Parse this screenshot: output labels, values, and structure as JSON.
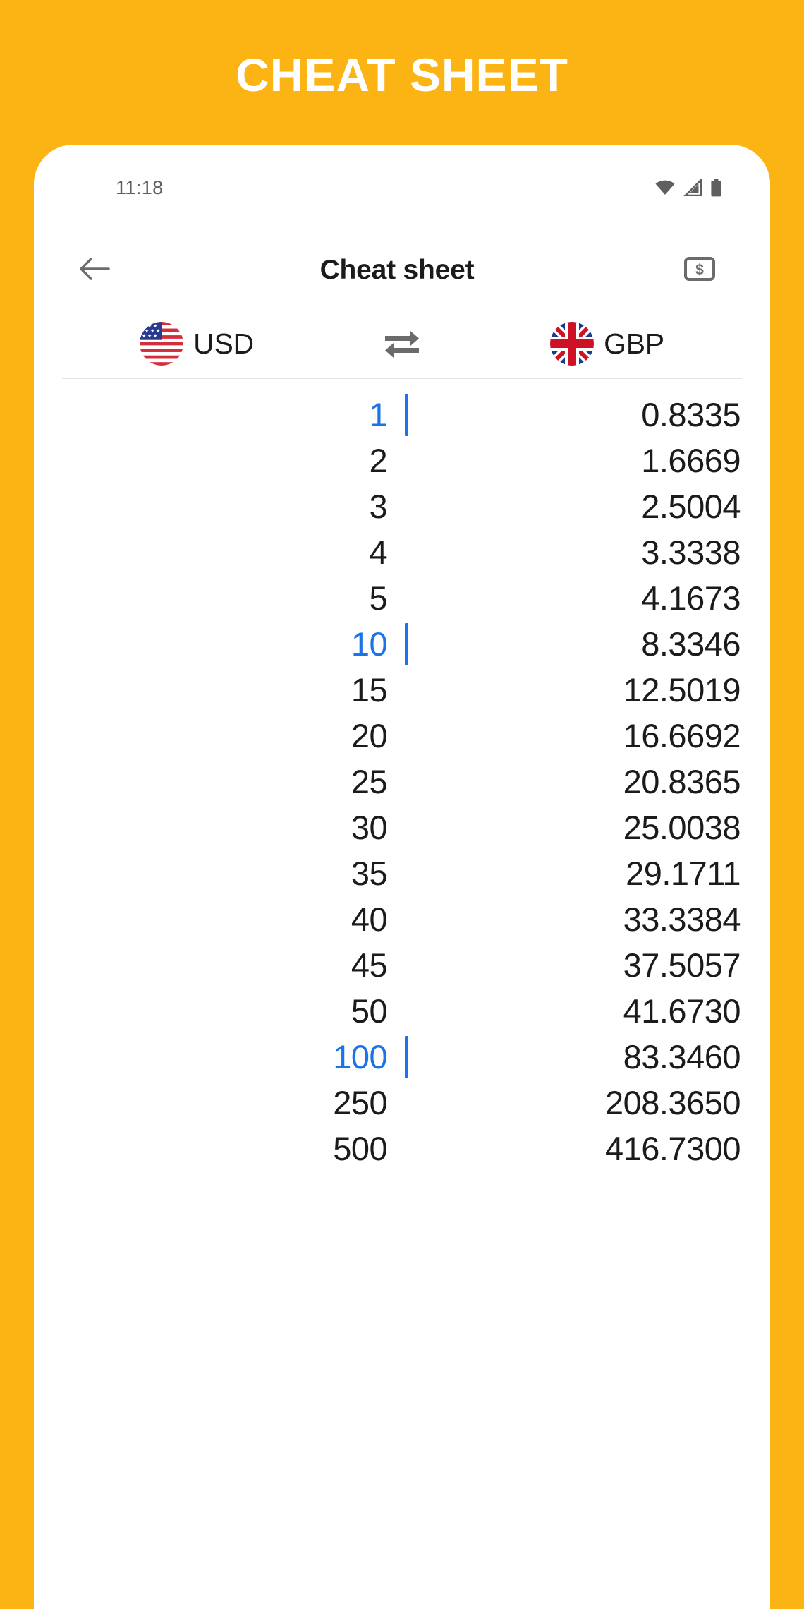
{
  "promo": {
    "headline": "CHEAT SHEET",
    "background_color": "#FCB415",
    "headline_color": "#FFFFFF"
  },
  "status_bar": {
    "time": "11:18",
    "icons": [
      "wifi-icon",
      "cell-signal-icon",
      "battery-icon"
    ],
    "icon_color": "#5F5F5F"
  },
  "app_bar": {
    "back_icon": "back-arrow-icon",
    "title": "Cheat sheet",
    "action_icon": "banknote-dollar-icon"
  },
  "currency_selector": {
    "from": {
      "code": "USD",
      "flag": "us-flag-icon"
    },
    "swap_icon": "swap-arrows-icon",
    "to": {
      "code": "GBP",
      "flag": "gb-flag-icon"
    }
  },
  "theme": {
    "accent": "#1A73E8",
    "text": "#1B1B1B",
    "muted": "#5F5F5F",
    "divider": "#E4E4E4"
  },
  "chart_data": {
    "type": "table",
    "title": "Cheat sheet",
    "columns": [
      "USD",
      "GBP"
    ],
    "rate": 0.8335,
    "xlabel": "USD",
    "ylabel": "GBP",
    "rows": [
      {
        "amount": "1",
        "converted": "0.8335",
        "highlight": true
      },
      {
        "amount": "2",
        "converted": "1.6669",
        "highlight": false
      },
      {
        "amount": "3",
        "converted": "2.5004",
        "highlight": false
      },
      {
        "amount": "4",
        "converted": "3.3338",
        "highlight": false
      },
      {
        "amount": "5",
        "converted": "4.1673",
        "highlight": false
      },
      {
        "amount": "10",
        "converted": "8.3346",
        "highlight": true
      },
      {
        "amount": "15",
        "converted": "12.5019",
        "highlight": false
      },
      {
        "amount": "20",
        "converted": "16.6692",
        "highlight": false
      },
      {
        "amount": "25",
        "converted": "20.8365",
        "highlight": false
      },
      {
        "amount": "30",
        "converted": "25.0038",
        "highlight": false
      },
      {
        "amount": "35",
        "converted": "29.1711",
        "highlight": false
      },
      {
        "amount": "40",
        "converted": "33.3384",
        "highlight": false
      },
      {
        "amount": "45",
        "converted": "37.5057",
        "highlight": false
      },
      {
        "amount": "50",
        "converted": "41.6730",
        "highlight": false
      },
      {
        "amount": "100",
        "converted": "83.3460",
        "highlight": true
      },
      {
        "amount": "250",
        "converted": "208.3650",
        "highlight": false
      },
      {
        "amount": "500",
        "converted": "416.7300",
        "highlight": false
      }
    ]
  }
}
